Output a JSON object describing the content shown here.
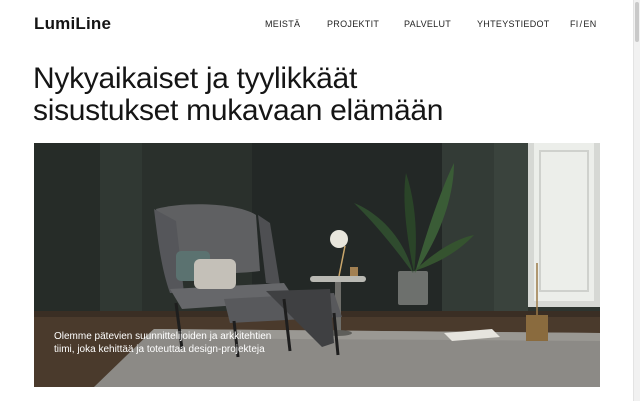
{
  "header": {
    "logo": "LumiLine",
    "nav": [
      {
        "label": "MEISTÄ"
      },
      {
        "label": "PROJEKTIT"
      },
      {
        "label": "PALVELUT"
      },
      {
        "label": "YHTEYSTIEDOT"
      }
    ],
    "lang": {
      "fi": "FI",
      "separator": "/",
      "en": "EN"
    }
  },
  "hero": {
    "title_line1": "Nykyaikaiset ja tyylikkäät",
    "title_line2": "sisustukset mukavaan elämään",
    "caption": "Olemme pätevien suunnittelijoiden ja arkkitehtien tiimi, joka kehittää ja toteuttaa design-projekteja"
  },
  "colors": {
    "wall": "#2d342f",
    "floor": "#4a3a2c",
    "rug": "#8c8a86",
    "chair": "#5f6062",
    "background": "#ffffff"
  }
}
